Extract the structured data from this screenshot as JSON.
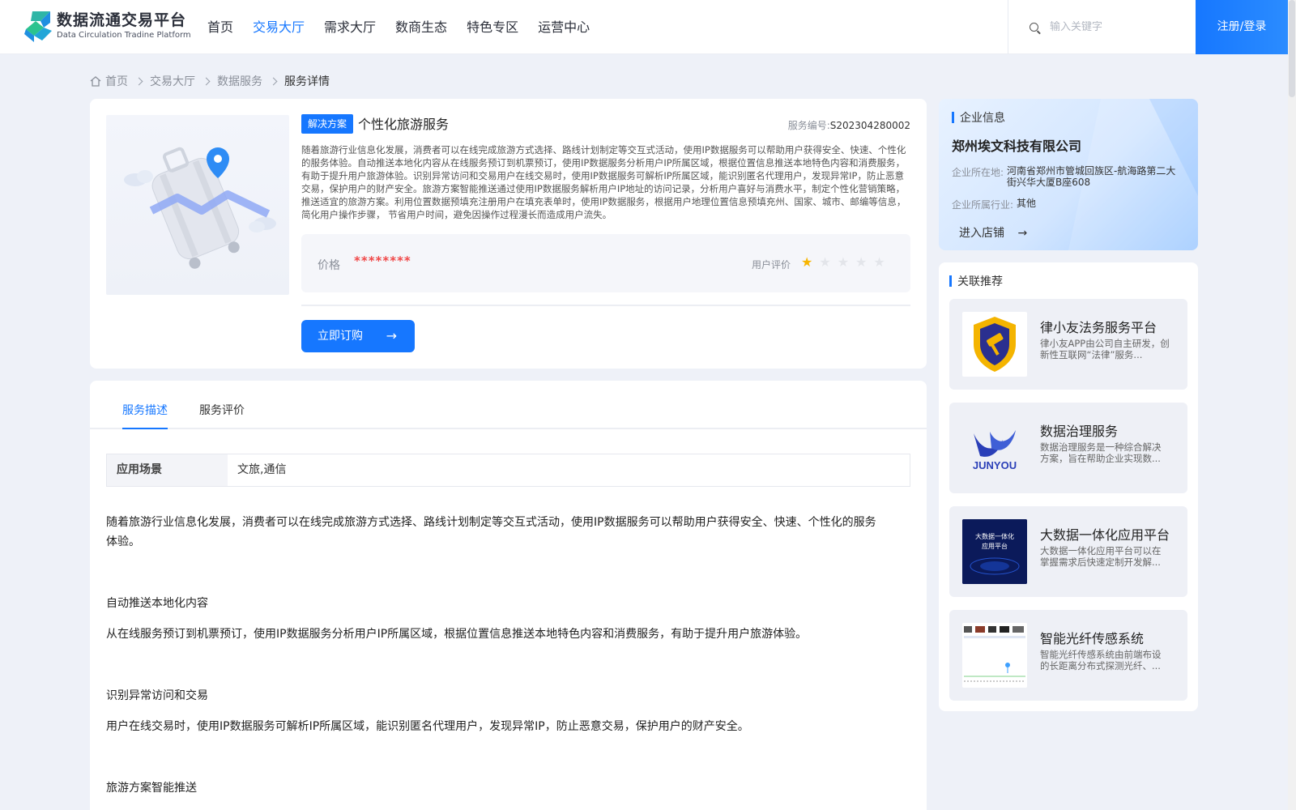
{
  "header": {
    "logo_cn": "数据流通交易平台",
    "logo_en": "Data Circulation Tradine Platform",
    "nav": [
      "首页",
      "交易大厅",
      "需求大厅",
      "数商生态",
      "特色专区",
      "运营中心"
    ],
    "nav_active": "交易大厅",
    "search_placeholder": "输入关键字",
    "login_label": "注册/登录"
  },
  "breadcrumb": [
    "首页",
    "交易大厅",
    "数据服务",
    "服务详情"
  ],
  "product": {
    "tag": "解决方案",
    "title": "个性化旅游服务",
    "code_label": "服务编号:",
    "code": "S202304280002",
    "description": "随着旅游行业信息化发展，消费者可以在线完成旅游方式选择、路线计划制定等交互式活动，使用IP数据服务可以帮助用户获得安全、快速、个性化的服务体验。自动推送本地化内容从在线服务预订到机票预订，使用IP数据服务分析用户IP所属区域，根据位置信息推送本地特色内容和消费服务，有助于提升用户旅游体验。识别异常访问和交易用户在线交易时，使用IP数据服务可解析IP所属区域，能识别匿名代理用户，发现异常IP，防止恶意交易，保护用户的财产安全。旅游方案智能推送通过使用IP数据服务解析用户IP地址的访问记录，分析用户喜好与消费水平，制定个性化营销策略，推送适宜的旅游方案。利用位置数据预填充注册用户在填充表单时，使用IP数据服务，根据用户地理位置信息预填充州、国家、城市、邮编等信息，简化用户操作步骤， 节省用户时间，避免因操作过程漫长而造成用户流失。",
    "price_label": "价格",
    "price": "********",
    "rating_label": "用户评价",
    "rating": 1,
    "rating_max": 5,
    "buy_label": "立即订购",
    "arrow": "→"
  },
  "company": {
    "section_title": "企业信息",
    "name": "郑州埃文科技有限公司",
    "location_label": "企业所在地:",
    "location": "河南省郑州市管城回族区-航海路第二大街兴华大厦B座608",
    "industry_label": "企业所属行业:",
    "industry": "其他",
    "enter_label": "进入店铺",
    "arrow": "→"
  },
  "related": {
    "section_title": "关联推荐",
    "items": [
      {
        "title": "律小友法务服务平台",
        "desc": "律小友APP由公司自主研发，创新性互联网“法律”服务..."
      },
      {
        "title": "数据治理服务",
        "desc": "数据治理服务是一种综合解决方案，旨在帮助企业实现数..."
      },
      {
        "title": "大数据一体化应用平台",
        "desc": "大数据一体化应用平台可以在掌握需求后快速定制开发解..."
      },
      {
        "title": "智能光纤传感系统",
        "desc": "智能光纤传感系统由前端布设的长距离分布式探测光纤、..."
      }
    ],
    "thumb_texts": {
      "junyou": "JUNYOU",
      "bigdata_line1": "大数据一体化",
      "bigdata_line2": "应用平台"
    }
  },
  "detail": {
    "tabs": [
      "服务描述",
      "服务评价"
    ],
    "scene_label": "应用场景",
    "scene_value": "文旅,通信",
    "paragraphs": [
      "随着旅游行业信息化发展，消费者可以在线完成旅游方式选择、路线计划制定等交互式活动，使用IP数据服务可以帮助用户获得安全、快速、个性化的服务体验。",
      "自动推送本地化内容",
      "从在线服务预订到机票预订，使用IP数据服务分析用户IP所属区域，根据位置信息推送本地特色内容和消费服务，有助于提升用户旅游体验。",
      "识别异常访问和交易",
      "用户在线交易时，使用IP数据服务可解析IP所属区域，能识别匿名代理用户，发现异常IP，防止恶意交易，保护用户的财产安全。",
      "旅游方案智能推送"
    ]
  },
  "colors": {
    "accent": "#1677ff",
    "price": "#f04848",
    "star": "#f7b500"
  }
}
